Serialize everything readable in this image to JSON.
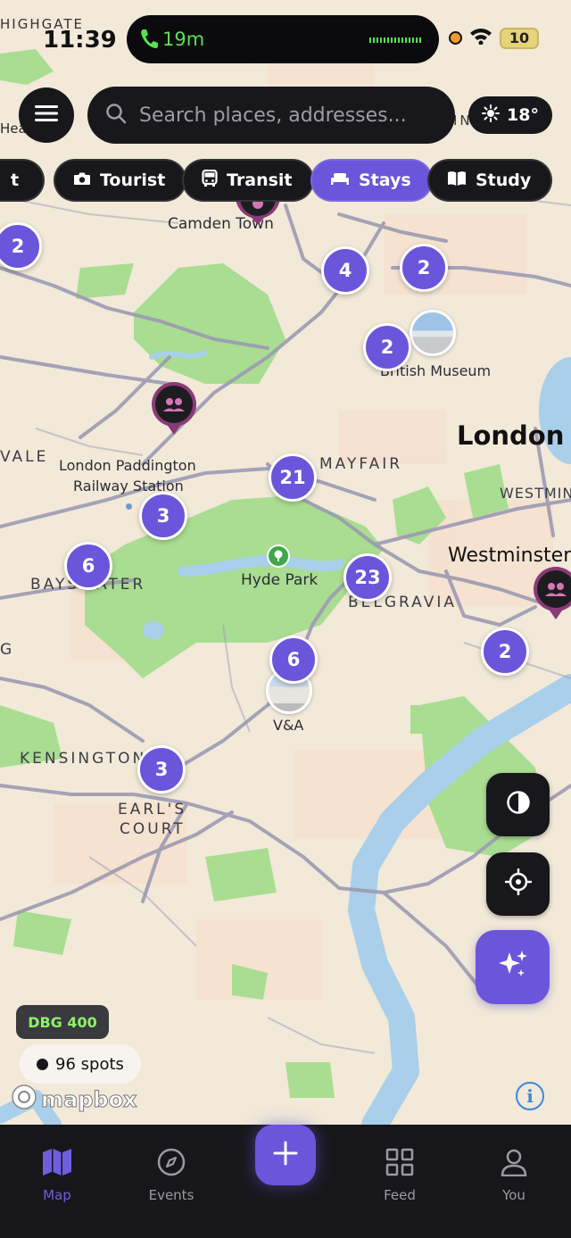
{
  "status_bar": {
    "time": "11:39",
    "partial_label": "HIGHGATE",
    "call_duration": "19m",
    "battery": "10"
  },
  "search": {
    "placeholder": "Search places, addresses..."
  },
  "weather": {
    "temperature": "18°",
    "icon": "sun-icon"
  },
  "categories": [
    {
      "label": "t",
      "icon": "partial",
      "active": false
    },
    {
      "label": "Tourist",
      "icon": "camera-icon",
      "active": false
    },
    {
      "label": "Transit",
      "icon": "bus-icon",
      "active": false
    },
    {
      "label": "Stays",
      "icon": "bed-icon",
      "active": true
    },
    {
      "label": "Study",
      "icon": "book-icon",
      "active": false
    }
  ],
  "map": {
    "labels": {
      "camden": "Camden Town",
      "british_museum": "British Museum",
      "london": "London",
      "mayfair": "MAYFAIR",
      "westminster_district": "WESTMIN",
      "westminster": "Westminster",
      "vale": "VALE",
      "paddington_1": "London Paddington",
      "paddington_2": "Railway Station",
      "bayswater": "BAYSWATER",
      "hyde_park": "Hyde Park",
      "belgravia": "BELGRAVIA",
      "g": "G",
      "va": "V&A",
      "kensington": "KENSINGTON",
      "earls_1": "EARL'S",
      "earls_2": "COURT",
      "hea": "Hea",
      "in": "IN"
    },
    "clusters": [
      "2",
      "4",
      "2",
      "2",
      "21",
      "3",
      "6",
      "23",
      "2",
      "6",
      "3"
    ]
  },
  "fabs": {
    "contrast": "contrast-icon",
    "locate": "crosshair-icon",
    "ai": "sparkles-icon"
  },
  "debug_badge": "DBG 400",
  "spots_count": "96 spots",
  "attribution": "mapbox",
  "tabs": [
    {
      "label": "Map",
      "icon": "map-icon",
      "active": true
    },
    {
      "label": "Events",
      "icon": "compass-icon",
      "active": false
    },
    {
      "label": "Feed",
      "icon": "grid-icon",
      "active": false
    },
    {
      "label": "You",
      "icon": "person-icon",
      "active": false
    }
  ],
  "colors": {
    "accent": "#6A55DB",
    "map_land": "#F2E9D9",
    "park": "#A6DC8E",
    "water": "#A9CFEA",
    "road": "#9B9AB4",
    "dark_surface": "#18181C"
  }
}
